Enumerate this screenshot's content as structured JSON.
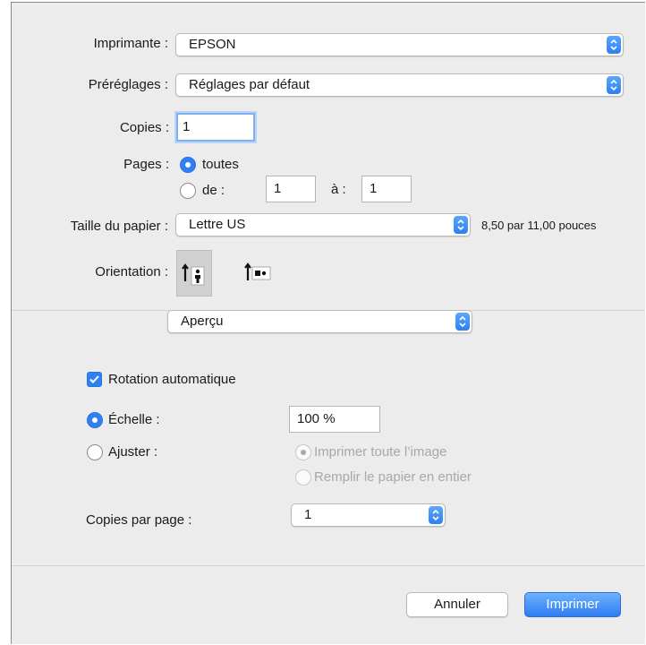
{
  "printer": {
    "label": "Imprimante :",
    "value": "EPSON"
  },
  "presets": {
    "label": "Préréglages :",
    "value": "Réglages par défaut"
  },
  "copies": {
    "label": "Copies :",
    "value": "1"
  },
  "pages": {
    "label": "Pages :",
    "all_label": "toutes",
    "from_label": "de :",
    "from_value": "1",
    "to_label": "à :",
    "to_value": "1",
    "selected": "toutes"
  },
  "paper_size": {
    "label": "Taille du papier :",
    "value": "Lettre US",
    "dimensions": "8,50 par 11,00 pouces"
  },
  "orientation": {
    "label": "Orientation :",
    "options": [
      "portrait",
      "landscape"
    ],
    "selected": "portrait"
  },
  "section_popup": {
    "value": "Aperçu"
  },
  "auto_rotate": {
    "label": "Rotation automatique",
    "checked": true
  },
  "scale": {
    "label": "Échelle :",
    "value": "100 %",
    "selected": true
  },
  "fit": {
    "label": "Ajuster :",
    "selected": false,
    "option_print_entire": "Imprimer toute l’image",
    "option_fill_paper": "Remplir le papier en entier"
  },
  "copies_per_page": {
    "label": "Copies par page :",
    "value": "1"
  },
  "buttons": {
    "cancel": "Annuler",
    "print": "Imprimer"
  },
  "colors": {
    "accent": "#2f80f5",
    "background": "#ececec",
    "disabled_text": "#a8a8a8"
  }
}
